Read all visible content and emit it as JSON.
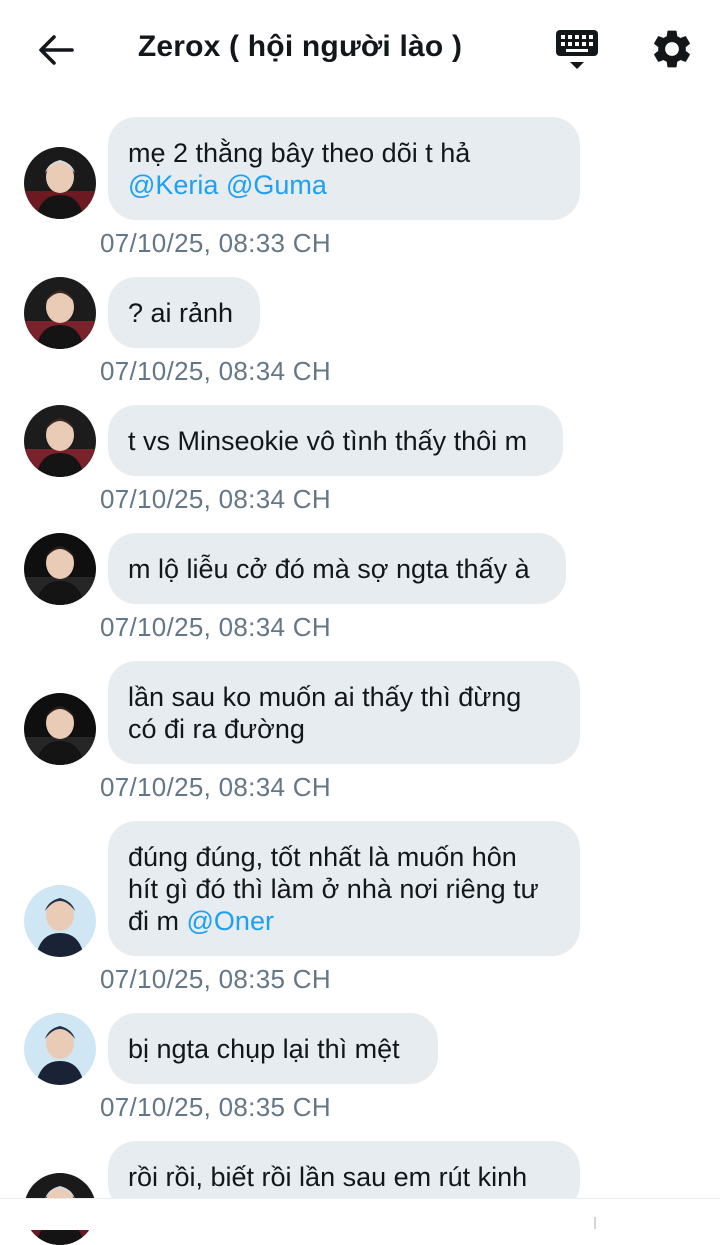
{
  "header": {
    "back_icon": "arrow-left-icon",
    "title": "Zerox ( hội người lào )",
    "keyboard_icon": "keyboard-icon",
    "settings_icon": "gear-icon"
  },
  "messages": [
    {
      "lines": [
        [
          {
            "t": "mẹ 2 thằng bây theo dõi t hả"
          }
        ],
        [
          {
            "t": "@Keria",
            "m": true
          },
          {
            "t": " "
          },
          {
            "t": "@Guma",
            "m": true
          }
        ]
      ],
      "timestamp": "07/10/25, 08:33 CH"
    },
    {
      "lines": [
        [
          {
            "t": "? ai rảnh"
          }
        ]
      ],
      "timestamp": "07/10/25, 08:34 CH"
    },
    {
      "lines": [
        [
          {
            "t": "t vs Minseokie vô tình thấy thôi m"
          }
        ]
      ],
      "timestamp": "07/10/25, 08:34 CH"
    },
    {
      "lines": [
        [
          {
            "t": "m lộ liễu cở đó mà sợ ngta thấy à"
          }
        ]
      ],
      "timestamp": "07/10/25, 08:34 CH"
    },
    {
      "lines": [
        [
          {
            "t": "lần sau ko muốn ai thấy thì đừng"
          }
        ],
        [
          {
            "t": "có đi ra đường"
          }
        ]
      ],
      "timestamp": "07/10/25, 08:34 CH"
    },
    {
      "lines": [
        [
          {
            "t": "đúng đúng, tốt nhất là muốn hôn"
          }
        ],
        [
          {
            "t": "hít gì đó thì làm ở nhà nơi riêng tư"
          }
        ],
        [
          {
            "t": "đi m "
          },
          {
            "t": "@Oner",
            "m": true
          }
        ]
      ],
      "timestamp": "07/10/25, 08:35 CH"
    },
    {
      "lines": [
        [
          {
            "t": "bị ngta chụp lại thì mệt"
          }
        ]
      ],
      "timestamp": "07/10/25, 08:35 CH"
    },
    {
      "lines": [
        [
          {
            "t": "rồi rồi, biết rồi lần sau em rút kinh"
          }
        ]
      ],
      "timestamp": ""
    }
  ],
  "colors": {
    "bubble": "#e6ecf0",
    "mention": "#1da1f2",
    "timestamp": "#657786",
    "text": "#14171a"
  }
}
